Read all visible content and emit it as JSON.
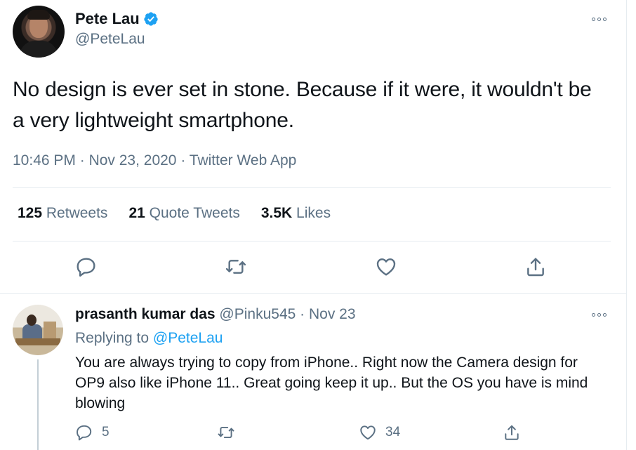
{
  "tweet": {
    "author_name": "Pete Lau",
    "author_handle": "@PeteLau",
    "verified": true,
    "text": "No design is ever set in stone. Because if it were, it wouldn't be a very lightweight smartphone.",
    "time": "10:46 PM",
    "date": "Nov 23, 2020",
    "source": "Twitter Web App",
    "separator": " · ",
    "stats": {
      "retweets_count": "125",
      "retweets_label": "Retweets",
      "quotes_count": "21",
      "quotes_label": "Quote Tweets",
      "likes_count": "3.5K",
      "likes_label": "Likes"
    }
  },
  "reply": {
    "author_name": "prasanth kumar das",
    "author_handle": "@Pinku545",
    "date": "Nov 23",
    "separator": " · ",
    "replying_label": "Replying to",
    "replying_mention": "@PeteLau",
    "text": "You are always trying to copy from iPhone.. Right now the Camera design for OP9 also like iPhone 11.. Great going keep it up.. But the OS you have is mind blowing",
    "reply_count": "5",
    "retweet_count": "",
    "like_count": "34"
  },
  "colors": {
    "accent": "#1da1f2",
    "secondary_text": "#5b7083",
    "border": "#e6ecf0"
  },
  "icons": [
    "verified-badge-icon",
    "more-options-icon",
    "reply-icon",
    "retweet-icon",
    "like-icon",
    "share-icon"
  ]
}
